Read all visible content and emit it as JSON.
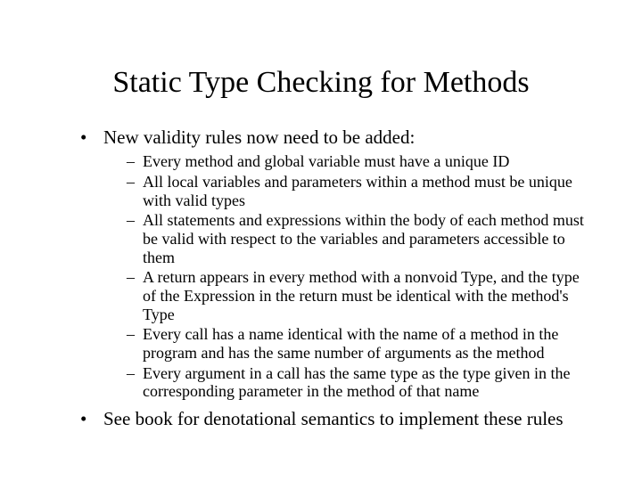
{
  "title": "Static Type Checking for Methods",
  "bullets": {
    "b0": "New validity rules now need to be added:",
    "b1": "See book for denotational semantics to implement these rules"
  },
  "sub": {
    "s0": "Every method and global variable must have a unique ID",
    "s1": "All local variables and parameters within a method must be unique with valid types",
    "s2": "All statements and expressions within the body of each method must be valid with respect to the variables and parameters accessible to them",
    "s3": "A return appears in every method with a nonvoid Type, and the type of the Expression in the return must be identical with the method's Type",
    "s4": "Every call has a name identical with the name of a method in the program and has the same number of arguments as the method",
    "s5": "Every argument in a call has the same type as the type given in the corresponding parameter in the method of that name"
  }
}
